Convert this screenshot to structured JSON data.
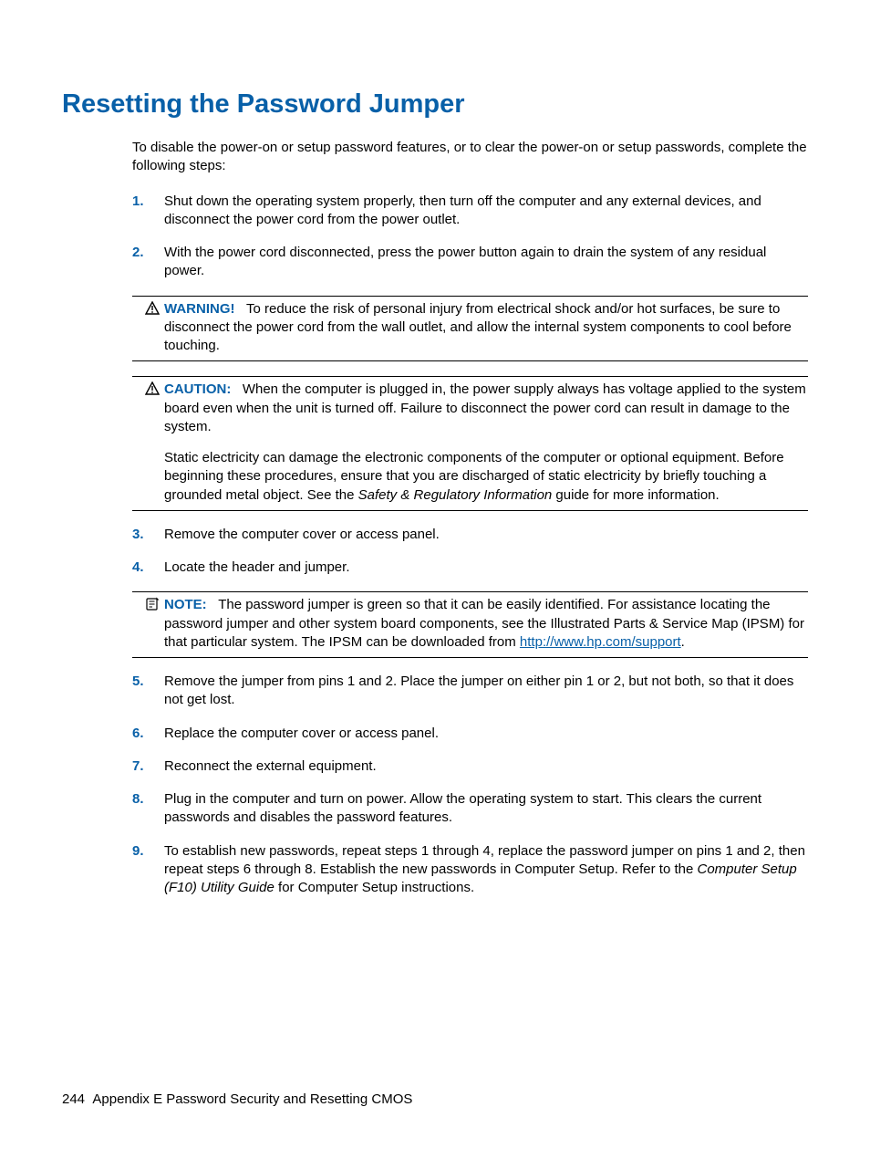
{
  "title": "Resetting the Password Jumper",
  "intro": "To disable the power-on or setup password features, or to clear the power-on or setup passwords, complete the following steps:",
  "steps": {
    "s1": {
      "num": "1.",
      "text": "Shut down the operating system properly, then turn off the computer and any external devices, and disconnect the power cord from the power outlet."
    },
    "s2": {
      "num": "2.",
      "text": "With the power cord disconnected, press the power button again to drain the system of any residual power."
    },
    "s3": {
      "num": "3.",
      "text": "Remove the computer cover or access panel."
    },
    "s4": {
      "num": "4.",
      "text": "Locate the header and jumper."
    },
    "s5": {
      "num": "5.",
      "text": "Remove the jumper from pins 1 and 2. Place the jumper on either pin 1 or 2, but not both, so that it does not get lost."
    },
    "s6": {
      "num": "6.",
      "text": "Replace the computer cover or access panel."
    },
    "s7": {
      "num": "7.",
      "text": "Reconnect the external equipment."
    },
    "s8": {
      "num": "8.",
      "text": "Plug in the computer and turn on power. Allow the operating system to start. This clears the current passwords and disables the password features."
    },
    "s9": {
      "num": "9.",
      "text_a": "To establish new passwords, repeat steps 1 through 4, replace the password jumper on pins 1 and 2, then repeat steps 6 through 8. Establish the new passwords in Computer Setup. Refer to the ",
      "italic": "Computer Setup (F10) Utility Guide",
      "text_b": " for Computer Setup instructions."
    }
  },
  "warning": {
    "label": "WARNING!",
    "text": "To reduce the risk of personal injury from electrical shock and/or hot surfaces, be sure to disconnect the power cord from the wall outlet, and allow the internal system components to cool before touching."
  },
  "caution": {
    "label": "CAUTION:",
    "text1": "When the computer is plugged in, the power supply always has voltage applied to the system board even when the unit is turned off. Failure to disconnect the power cord can result in damage to the system.",
    "text2_a": "Static electricity can damage the electronic components of the computer or optional equipment. Before beginning these procedures, ensure that you are discharged of static electricity by briefly touching a grounded metal object. See the ",
    "italic": "Safety & Regulatory Information",
    "text2_b": " guide for more information."
  },
  "note": {
    "label": "NOTE:",
    "text_a": "The password jumper is green so that it can be easily identified. For assistance locating the password jumper and other system board components, see the Illustrated Parts & Service Map (IPSM) for that particular system. The IPSM can be downloaded from ",
    "link": "http://www.hp.com/support",
    "text_b": "."
  },
  "footer": {
    "page": "244",
    "appendix": "Appendix E   Password Security and Resetting CMOS"
  }
}
